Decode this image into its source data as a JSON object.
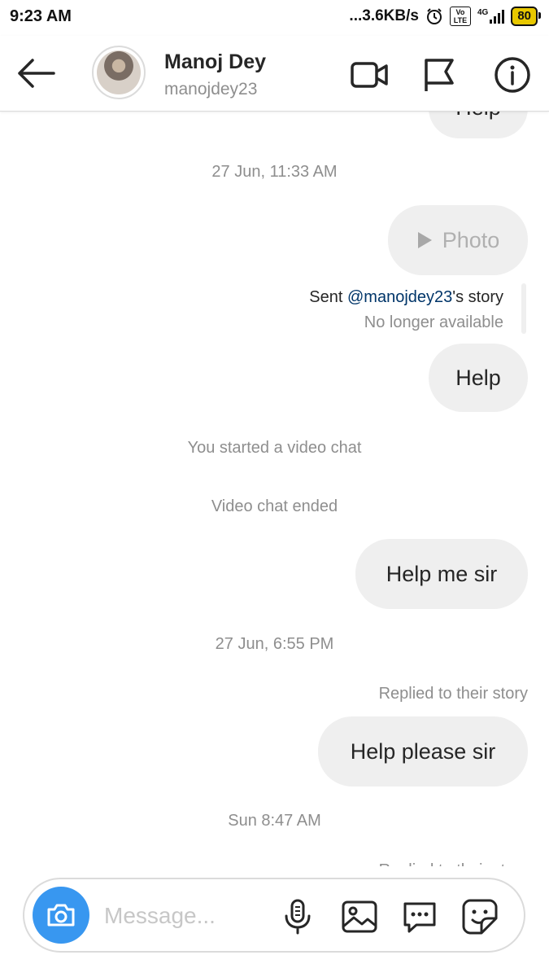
{
  "status_bar": {
    "time": "9:23 AM",
    "net_speed": "...3.6KB/s",
    "volte": "Vo LTE",
    "network": "4G",
    "battery": "80"
  },
  "header": {
    "name": "Manoj Dey",
    "username": "manojdey23",
    "icons": [
      "back-arrow-icon",
      "video-call-icon",
      "flag-icon",
      "info-icon"
    ]
  },
  "chat": {
    "top_partial_bubble": "Help",
    "ts1": "27 Jun, 11:33 AM",
    "photo_label": "Photo",
    "story_sent_prefix": "Sent ",
    "story_mention": "@manojdey23",
    "story_sent_suffix": "'s story",
    "story_unavailable": "No longer available",
    "msg_help": "Help",
    "video_started": "You started a video chat",
    "video_ended": "Video chat ended",
    "msg_help_me": "Help me sir",
    "ts2": "27 Jun, 6:55 PM",
    "replied_story": "Replied to their story",
    "msg_help_please": "Help please sir",
    "ts3": "Sun 8:47 AM",
    "bottom_partial": "Replied to their story"
  },
  "composer": {
    "placeholder": "Message...",
    "icons": [
      "camera-icon",
      "microphone-icon",
      "gallery-icon",
      "chat-bubble-icon",
      "sticker-icon"
    ]
  },
  "colors": {
    "accent_blue": "#3897f0",
    "bubble_bg": "#efefef",
    "meta_text": "#8e8e8e",
    "mention": "#003569"
  }
}
